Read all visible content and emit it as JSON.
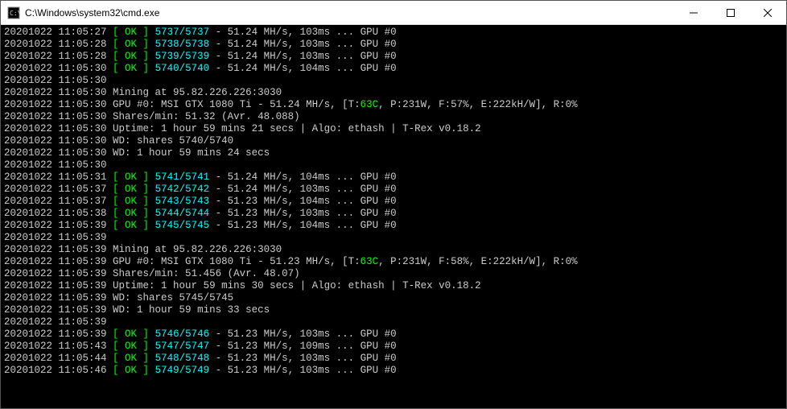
{
  "window": {
    "title": "C:\\Windows\\system32\\cmd.exe"
  },
  "lines": [
    {
      "type": "ok",
      "dt": "20201022 11:05:27",
      "shares": "5737/5737",
      "rate": "51.24 MH/s",
      "ms": "103ms",
      "gpu": "GPU #0"
    },
    {
      "type": "ok",
      "dt": "20201022 11:05:28",
      "shares": "5738/5738",
      "rate": "51.24 MH/s",
      "ms": "103ms",
      "gpu": "GPU #0"
    },
    {
      "type": "ok",
      "dt": "20201022 11:05:28",
      "shares": "5739/5739",
      "rate": "51.24 MH/s",
      "ms": "103ms",
      "gpu": "GPU #0"
    },
    {
      "type": "ok",
      "dt": "20201022 11:05:30",
      "shares": "5740/5740",
      "rate": "51.24 MH/s",
      "ms": "104ms",
      "gpu": "GPU #0"
    },
    {
      "type": "ts",
      "dt": "20201022 11:05:30"
    },
    {
      "type": "plain",
      "dt": "20201022 11:05:30",
      "text": "Mining at 95.82.226.226:3030"
    },
    {
      "type": "gpu",
      "dt": "20201022 11:05:30",
      "pre": "GPU #0: MSI GTX 1080 Ti - 51.24 MH/s, [T:",
      "temp": "63C",
      "post": ", P:231W, F:57%, E:222kH/W], R:0%"
    },
    {
      "type": "plain",
      "dt": "20201022 11:05:30",
      "text": "Shares/min: 51.32 (Avr. 48.088)"
    },
    {
      "type": "plain",
      "dt": "20201022 11:05:30",
      "text": "Uptime: 1 hour 59 mins 21 secs | Algo: ethash | T-Rex v0.18.2"
    },
    {
      "type": "plain",
      "dt": "20201022 11:05:30",
      "text": "WD: shares 5740/5740"
    },
    {
      "type": "plain",
      "dt": "20201022 11:05:30",
      "text": "WD: 1 hour 59 mins 24 secs"
    },
    {
      "type": "ts",
      "dt": "20201022 11:05:30"
    },
    {
      "type": "ok",
      "dt": "20201022 11:05:31",
      "shares": "5741/5741",
      "rate": "51.24 MH/s",
      "ms": "104ms",
      "gpu": "GPU #0"
    },
    {
      "type": "ok",
      "dt": "20201022 11:05:37",
      "shares": "5742/5742",
      "rate": "51.24 MH/s",
      "ms": "103ms",
      "gpu": "GPU #0"
    },
    {
      "type": "ok",
      "dt": "20201022 11:05:37",
      "shares": "5743/5743",
      "rate": "51.23 MH/s",
      "ms": "104ms",
      "gpu": "GPU #0"
    },
    {
      "type": "ok",
      "dt": "20201022 11:05:38",
      "shares": "5744/5744",
      "rate": "51.23 MH/s",
      "ms": "103ms",
      "gpu": "GPU #0"
    },
    {
      "type": "ok",
      "dt": "20201022 11:05:39",
      "shares": "5745/5745",
      "rate": "51.23 MH/s",
      "ms": "104ms",
      "gpu": "GPU #0"
    },
    {
      "type": "ts",
      "dt": "20201022 11:05:39"
    },
    {
      "type": "plain",
      "dt": "20201022 11:05:39",
      "text": "Mining at 95.82.226.226:3030"
    },
    {
      "type": "gpu",
      "dt": "20201022 11:05:39",
      "pre": "GPU #0: MSI GTX 1080 Ti - 51.23 MH/s, [T:",
      "temp": "63C",
      "post": ", P:231W, F:58%, E:222kH/W], R:0%"
    },
    {
      "type": "plain",
      "dt": "20201022 11:05:39",
      "text": "Shares/min: 51.456 (Avr. 48.07)"
    },
    {
      "type": "plain",
      "dt": "20201022 11:05:39",
      "text": "Uptime: 1 hour 59 mins 30 secs | Algo: ethash | T-Rex v0.18.2"
    },
    {
      "type": "plain",
      "dt": "20201022 11:05:39",
      "text": "WD: shares 5745/5745"
    },
    {
      "type": "plain",
      "dt": "20201022 11:05:39",
      "text": "WD: 1 hour 59 mins 33 secs"
    },
    {
      "type": "ts",
      "dt": "20201022 11:05:39"
    },
    {
      "type": "ok",
      "dt": "20201022 11:05:39",
      "shares": "5746/5746",
      "rate": "51.23 MH/s",
      "ms": "103ms",
      "gpu": "GPU #0"
    },
    {
      "type": "ok",
      "dt": "20201022 11:05:43",
      "shares": "5747/5747",
      "rate": "51.23 MH/s",
      "ms": "109ms",
      "gpu": "GPU #0"
    },
    {
      "type": "ok",
      "dt": "20201022 11:05:44",
      "shares": "5748/5748",
      "rate": "51.23 MH/s",
      "ms": "103ms",
      "gpu": "GPU #0"
    },
    {
      "type": "ok",
      "dt": "20201022 11:05:46",
      "shares": "5749/5749",
      "rate": "51.23 MH/s",
      "ms": "103ms",
      "gpu": "GPU #0"
    }
  ]
}
